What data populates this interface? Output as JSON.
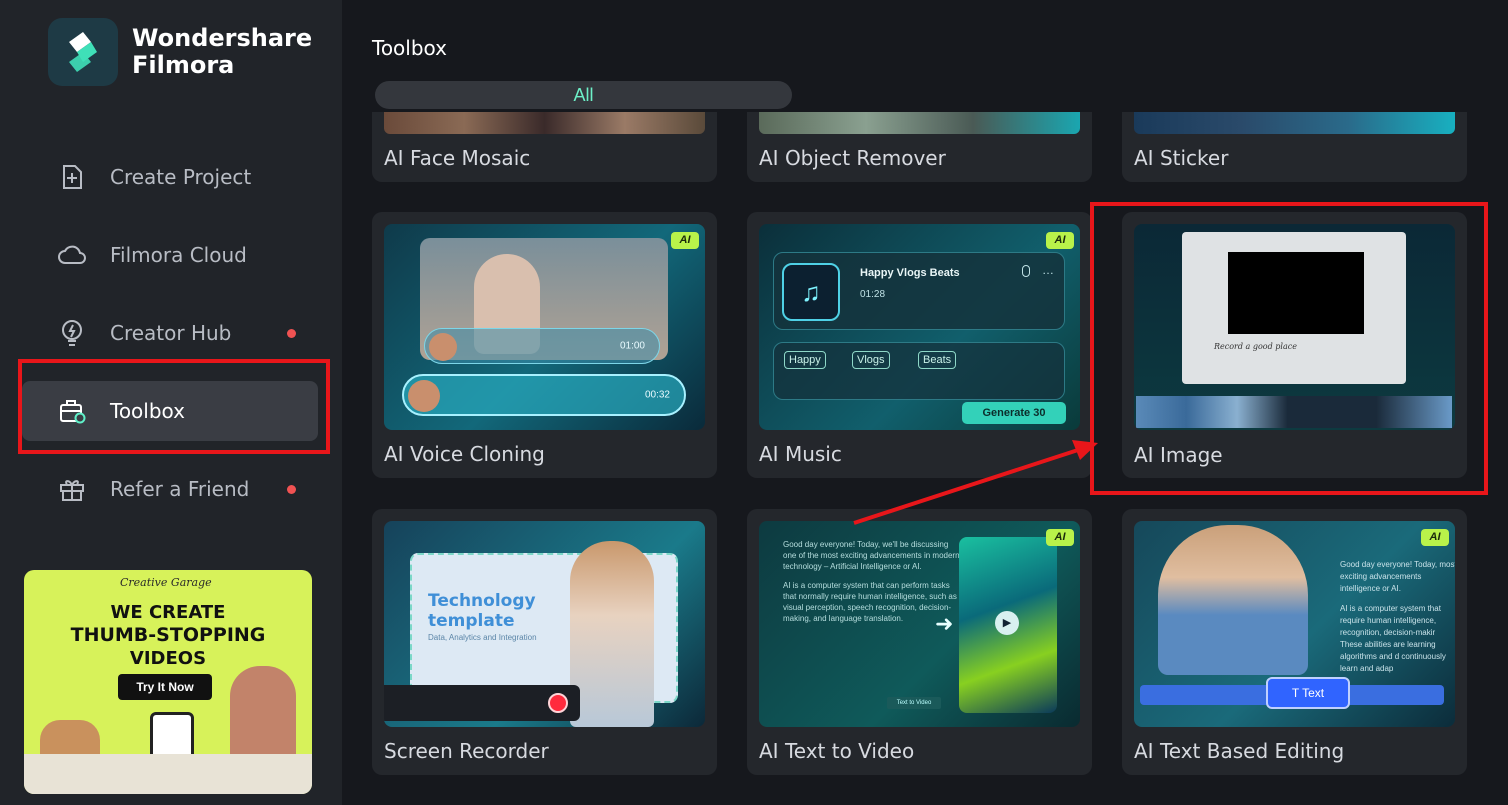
{
  "app": {
    "brand_line1": "Wondershare",
    "brand_line2": "Filmora"
  },
  "sidebar": {
    "items": [
      {
        "label": "Create Project",
        "icon": "plus-square-icon",
        "dot": false,
        "active": false
      },
      {
        "label": "Filmora Cloud",
        "icon": "cloud-icon",
        "dot": false,
        "active": false
      },
      {
        "label": "Creator Hub",
        "icon": "bulb-icon",
        "dot": true,
        "active": false
      },
      {
        "label": "Toolbox",
        "icon": "toolbox-icon",
        "dot": false,
        "active": true
      },
      {
        "label": "Refer a Friend",
        "icon": "gift-icon",
        "dot": true,
        "active": false
      }
    ]
  },
  "promo": {
    "tag": "Creative Garage",
    "line1": "WE CREATE",
    "line2": "THUMB-STOPPING",
    "line3": "VIDEOS",
    "cta": "Try It Now"
  },
  "main": {
    "title": "Toolbox",
    "filter": "All",
    "row0": [
      "AI Face Mosaic",
      "AI Object Remover",
      "AI Sticker"
    ],
    "cards": {
      "voice": {
        "label": "AI Voice Cloning",
        "badge": "AI",
        "time_small": "01:00",
        "time_big": "00:32"
      },
      "music": {
        "label": "AI Music",
        "badge": "AI",
        "track": "Happy Vlogs Beats",
        "time": "01:28",
        "tags": [
          "Happy",
          "Vlogs",
          "Beats"
        ],
        "generate": "Generate",
        "credits": "30"
      },
      "image": {
        "label": "AI Image",
        "caption": "Record a good place"
      },
      "recorder": {
        "label": "Screen Recorder",
        "heading_1": "Technology",
        "heading_2": "template",
        "sub": "Data, Analytics and Integration"
      },
      "ttv": {
        "label": "AI Text to Video",
        "badge": "AI",
        "para1": "Good day everyone! Today, we'll be discussing one of the most exciting advancements in modern technology – Artificial Intelligence or AI.",
        "para2": "AI is a computer system that can perform tasks that normally require human intelligence, such as visual perception, speech recognition, decision-making, and language translation.",
        "button": "Text to Video"
      },
      "editing": {
        "label": "AI Text Based Editing",
        "badge": "AI",
        "para1": "Good day everyone! Today, most exciting advancements intelligence or AI.",
        "para2": "AI is a computer system that require human intelligence, recognition, decision-makir These abilities are learning algorithms and d continuously learn and adap",
        "text_chip": "Text"
      }
    }
  },
  "colors": {
    "highlight": "#e8161a",
    "accent": "#6df0c8",
    "notify_dot": "#f05252"
  }
}
